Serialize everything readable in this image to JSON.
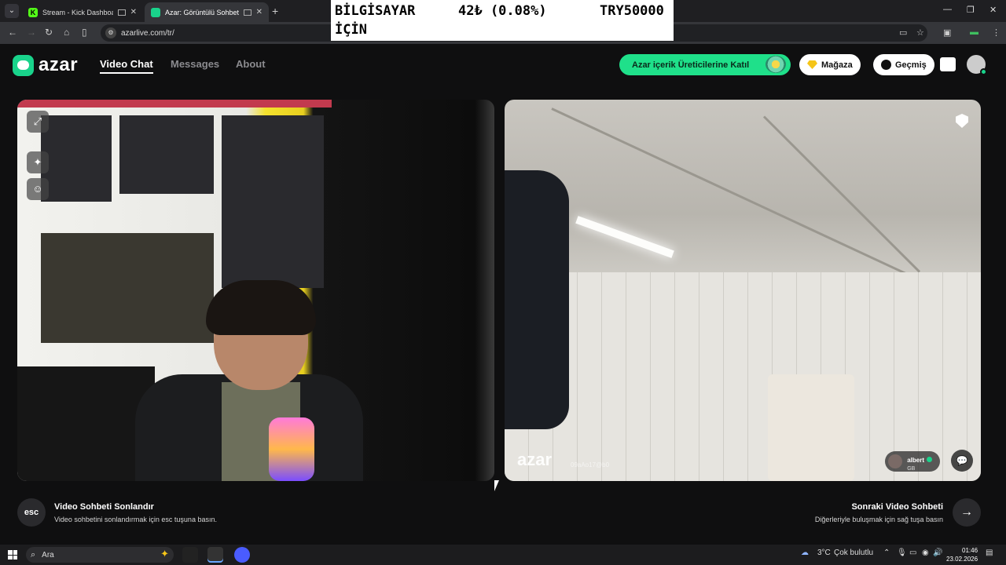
{
  "browser": {
    "tabs": [
      {
        "title": "Stream - Kick Dashboard",
        "favicon": "kick-icon"
      },
      {
        "title": "Azar: Görüntülü Sohbet & V",
        "favicon": "azar-icon"
      }
    ],
    "url": "azarlive.com/tr/"
  },
  "overlay_ticker": {
    "line1": "BİLGİSAYAR",
    "line2": "İÇİN",
    "amount": "42₺ (0.08%)",
    "goal": "TRY50000"
  },
  "app": {
    "logo_text": "azar",
    "nav": [
      "Video Chat",
      "Messages",
      "About"
    ],
    "creator_cta": "Azar içerik Üreticilerine Katıl",
    "store_label": "Mağaza",
    "history_label": "Geçmiş",
    "accent_color": "#1fe08a"
  },
  "right_video": {
    "watermark": "azar",
    "watermark_id": "09aAo17@b0",
    "peer_name": "albert",
    "peer_country": "GB"
  },
  "actions": {
    "esc_key": "esc",
    "end_title": "Video Sohbeti Sonlandır",
    "end_sub": "Video sohbetini sonlandırmak için esc tuşuna basın.",
    "next_title": "Sonraki Video Sohbeti",
    "next_sub": "Diğerleriyle buluşmak için sağ tuşa basın"
  },
  "taskbar": {
    "search_placeholder": "Ara",
    "weather": "3°C",
    "weather_desc": "Çok bulutlu",
    "time": "01:46",
    "date": "23.02.2026"
  }
}
